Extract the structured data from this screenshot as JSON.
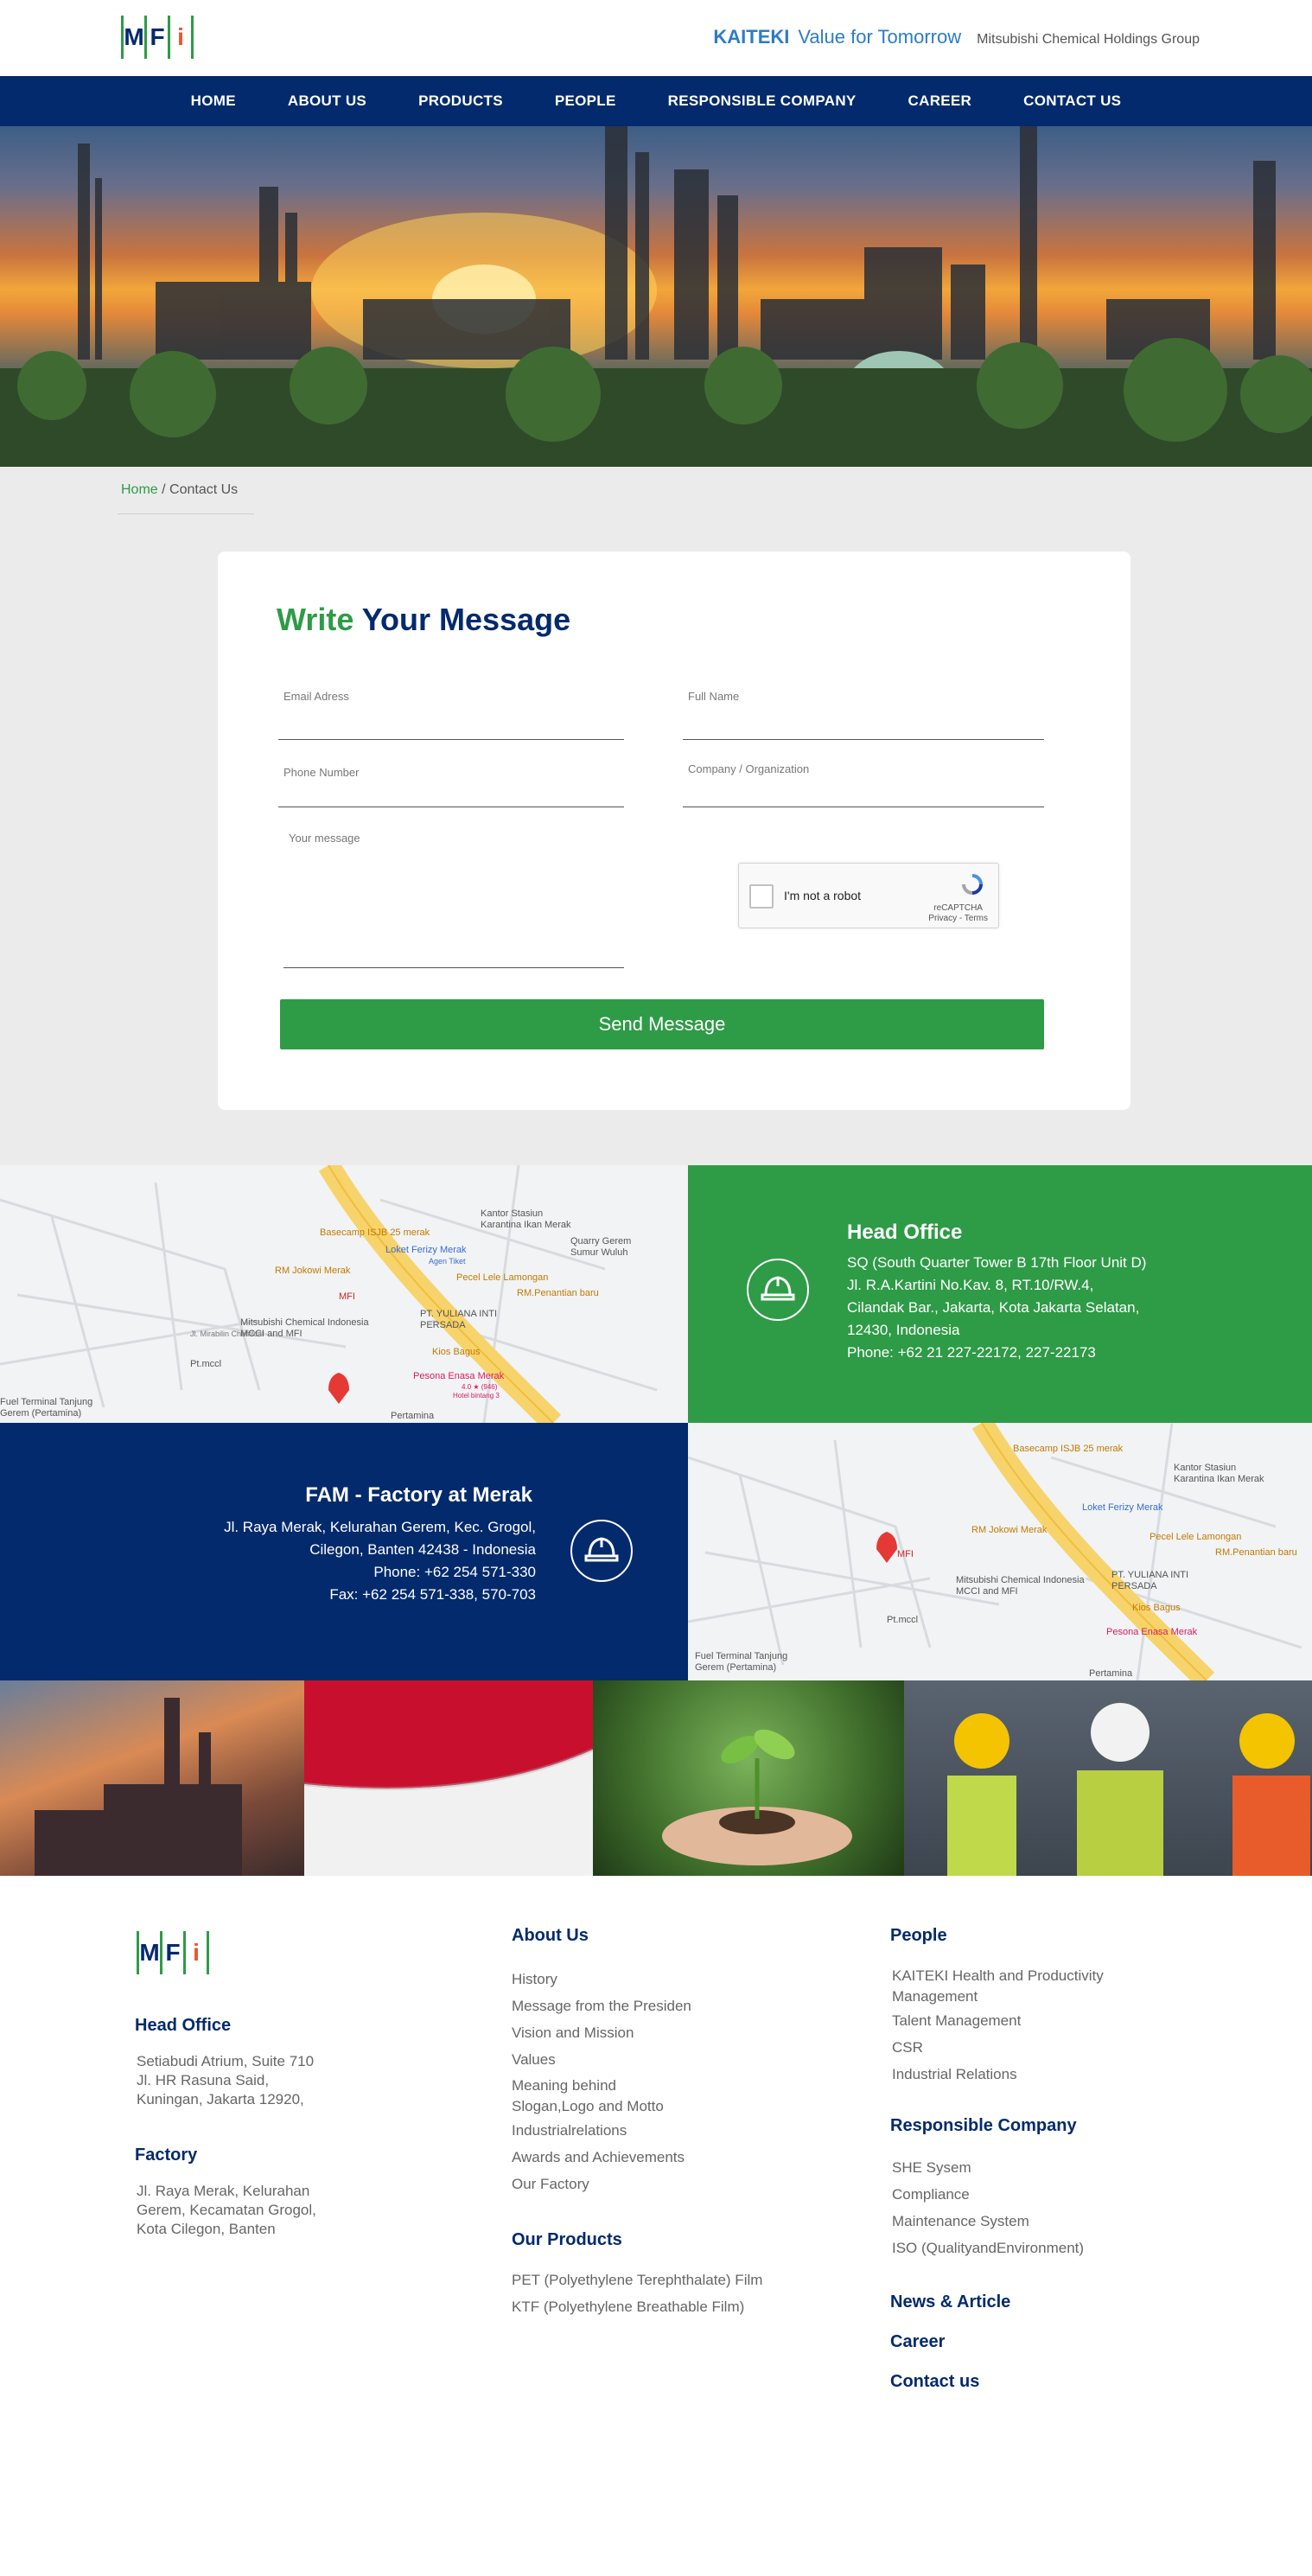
{
  "brand": {
    "letters": [
      "M",
      "F",
      "i"
    ],
    "kaiteki": "KAITEKI",
    "value": "Value for Tomorrow",
    "group": "Mitsubishi Chemical Holdings Group"
  },
  "nav": [
    "HOME",
    "ABOUT US",
    "PRODUCTS",
    "PEOPLE",
    "RESPONSIBLE COMPANY",
    "CAREER",
    "CONTACT US"
  ],
  "breadcrumb": {
    "home": "Home",
    "sep": " / ",
    "current": "Contact Us"
  },
  "form": {
    "title_green": "Write",
    "title_blue": "Your Message",
    "email_label": "Email Adress",
    "name_label": "Full Name",
    "phone_label": "Phone Number",
    "company_label": "Company / Organization",
    "message_label": "Your message",
    "recaptcha_label": "I'm not a robot",
    "recaptcha_brand": "reCAPTCHA",
    "recaptcha_links": "Privacy - Terms",
    "send": "Send Message"
  },
  "map_labels": {
    "basecamp": "Basecamp ISJB 25 merak",
    "stasiun": "Kantor Stasiun Karantina Ikan Merak",
    "quarry": "Quarry Gerem Sumur Wuluh",
    "loket": "Loket Ferizy Merak",
    "agen": "Agen Tiket",
    "jokowi": "RM Jokowi Merak",
    "pecel": "Pecel Lele Lamongan",
    "penantian": "RM.Penantian baru",
    "mfi": "MFI",
    "mitsubishi": "Mitsubishi Chemical Indonesia MCCI and MFI",
    "yuliana": "PT. YULIANA INTI PERSADA",
    "kios": "Kios Bagus",
    "mccl": "Pt.mccl",
    "pesona": "Pesona Enasa Merak",
    "rating": "4.0 ★ (946)",
    "bintang": "Hotel bintang 3",
    "fuel": "Fuel Terminal Tanjung Gerem (Pertamina)",
    "pertamina": "Pertamina",
    "street": "Jl. Mirabilin Chemical"
  },
  "head_office": {
    "title": "Head Office",
    "lines": [
      "SQ (South Quarter Tower B 17th Floor Unit D)",
      "Jl. R.A.Kartini No.Kav. 8, RT.10/RW.4,",
      "Cilandak Bar., Jakarta, Kota Jakarta Selatan,",
      "12430, Indonesia",
      "Phone: +62 21 227-22172, 227-22173"
    ]
  },
  "factory": {
    "title": "FAM - Factory at Merak",
    "lines": [
      "Jl. Raya Merak, Kelurahan Gerem, Kec. Grogol,",
      "Cilegon, Banten 42438 - Indonesia",
      "Phone:  +62 254 571-330",
      "Fax: +62 254 571-338, 570-703"
    ]
  },
  "footer": {
    "head_office_title": "Head Office",
    "head_office_lines": [
      "Setiabudi Atrium, Suite 710",
      "Jl. HR Rasuna Said,",
      "Kuningan, Jakarta 12920,"
    ],
    "factory_title": "Factory",
    "factory_lines": [
      "Jl. Raya Merak, Kelurahan",
      "Gerem, Kecamatan Grogol,",
      "Kota Cilegon, Banten"
    ],
    "about_title": "About Us",
    "about_items": [
      "History",
      "Message from the Presiden",
      "Vision and Mission",
      "Values",
      "Meaning behind",
      "Slogan,Logo and Motto",
      "Industrialrelations",
      "Awards and Achievements",
      "Our Factory"
    ],
    "products_title": "Our Products",
    "products_items": [
      "PET (Polyethylene Terephthalate) Film",
      "KTF (Polyethylene Breathable Film)"
    ],
    "people_title": "People",
    "people_items": [
      "KAITEKI Health and Productivity",
      "Management",
      "Talent Management",
      "CSR",
      "Industrial Relations"
    ],
    "responsible_title": "Responsible Company",
    "responsible_items": [
      "SHE Sysem",
      "Compliance",
      "Maintenance System",
      "ISO (QualityandEnvironment)"
    ],
    "news": "News & Article",
    "career": "Career",
    "contact": "Contact us"
  },
  "colors": {
    "navy": "#032a6c",
    "green": "#2e9b47",
    "blue": "#2c7cc8",
    "gray_bg": "#ebebeb"
  }
}
